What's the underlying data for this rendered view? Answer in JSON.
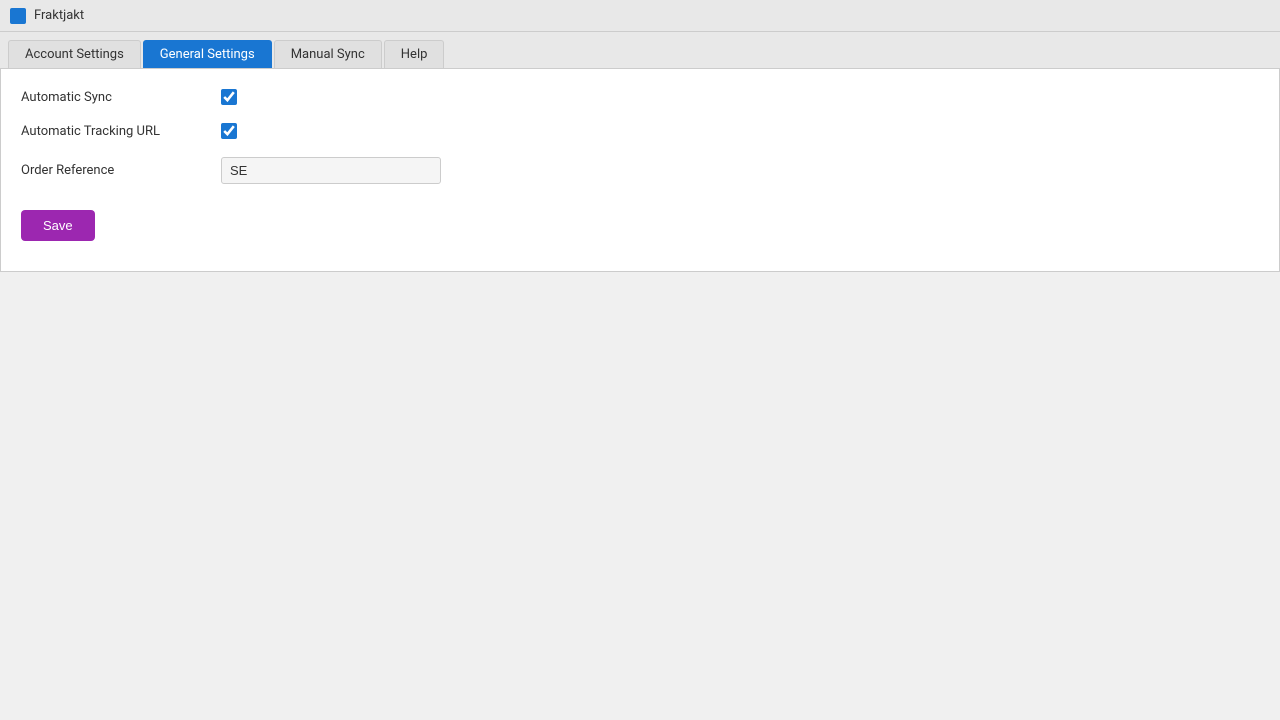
{
  "app": {
    "title": "Fraktjakt",
    "icon_color": "#1976d2"
  },
  "tabs": [
    {
      "id": "account-settings",
      "label": "Account Settings",
      "active": false
    },
    {
      "id": "general-settings",
      "label": "General Settings",
      "active": true
    },
    {
      "id": "manual-sync",
      "label": "Manual Sync",
      "active": false
    },
    {
      "id": "help",
      "label": "Help",
      "active": false
    }
  ],
  "form": {
    "automatic_sync_label": "Automatic Sync",
    "automatic_sync_checked": true,
    "automatic_tracking_url_label": "Automatic Tracking URL",
    "automatic_tracking_url_checked": true,
    "order_reference_label": "Order Reference",
    "order_reference_value": "SE",
    "save_button_label": "Save"
  }
}
